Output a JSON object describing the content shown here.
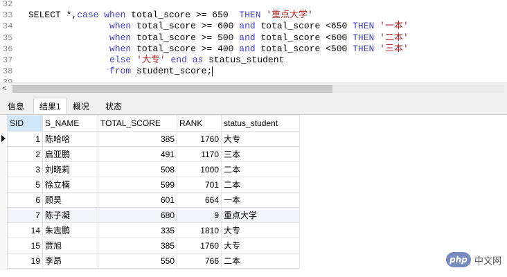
{
  "editor": {
    "lines": [
      {
        "num": "32",
        "parts": []
      },
      {
        "num": "33",
        "parts": [
          [
            "",
            "SELECT *,"
          ],
          [
            "kw",
            "case"
          ],
          [
            "",
            " "
          ],
          [
            "kw",
            "when"
          ],
          [
            "",
            " total_score >= 650  "
          ],
          [
            "kw",
            "THEN"
          ],
          [
            "",
            " "
          ],
          [
            "str",
            "'重点大学'"
          ]
        ]
      },
      {
        "num": "34",
        "parts": [
          [
            "",
            "               "
          ],
          [
            "kw",
            "when"
          ],
          [
            "",
            " total_score >= 600 "
          ],
          [
            "kw",
            "and"
          ],
          [
            "",
            " total_score <650 "
          ],
          [
            "kw",
            "THEN"
          ],
          [
            "",
            " "
          ],
          [
            "str",
            "'一本'"
          ]
        ]
      },
      {
        "num": "35",
        "parts": [
          [
            "",
            "               "
          ],
          [
            "kw",
            "when"
          ],
          [
            "",
            " total_score >= 500 "
          ],
          [
            "kw",
            "and"
          ],
          [
            "",
            " total_score <600 "
          ],
          [
            "kw",
            "THEN"
          ],
          [
            "",
            " "
          ],
          [
            "str",
            "'二本'"
          ]
        ]
      },
      {
        "num": "36",
        "parts": [
          [
            "",
            "               "
          ],
          [
            "kw",
            "when"
          ],
          [
            "",
            " total_score >= 400 "
          ],
          [
            "kw",
            "and"
          ],
          [
            "",
            " total_score <500 "
          ],
          [
            "kw",
            "THEN"
          ],
          [
            "",
            " "
          ],
          [
            "str",
            "'三本'"
          ]
        ]
      },
      {
        "num": "37",
        "parts": [
          [
            "",
            "               "
          ],
          [
            "kw",
            "else"
          ],
          [
            "",
            " "
          ],
          [
            "str",
            "'大专'"
          ],
          [
            "",
            " "
          ],
          [
            "kw",
            "end"
          ],
          [
            "",
            " "
          ],
          [
            "kw",
            "as"
          ],
          [
            "",
            " status_student"
          ]
        ]
      },
      {
        "num": "38",
        "parts": [
          [
            "",
            "               "
          ],
          [
            "kw",
            "from"
          ],
          [
            "",
            " student_score;"
          ]
        ]
      },
      {
        "num": "39",
        "parts": []
      }
    ]
  },
  "scrollbar": {
    "left_arrow": "<"
  },
  "tabs": [
    {
      "label": "信息",
      "active": false
    },
    {
      "label": "结果1",
      "active": true
    },
    {
      "label": "概况",
      "active": false
    },
    {
      "label": "状态",
      "active": false
    }
  ],
  "table": {
    "columns": [
      "SID",
      "S_NAME",
      "TOTAL_SCORE",
      "RANK",
      "status_student"
    ],
    "rows": [
      [
        "1",
        "陈哈哈",
        "385",
        "1760",
        "大专"
      ],
      [
        "2",
        "启亚鹏",
        "491",
        "1170",
        "三本"
      ],
      [
        "3",
        "刘晓莉",
        "508",
        "1000",
        "二本"
      ],
      [
        "5",
        "徐立楠",
        "599",
        "701",
        "二本"
      ],
      [
        "6",
        "顾昊",
        "601",
        "664",
        "一本"
      ],
      [
        "7",
        "陈子凝",
        "680",
        "9",
        "重点大学"
      ],
      [
        "14",
        "朱志鹏",
        "335",
        "1810",
        "大专"
      ],
      [
        "15",
        "贾旭",
        "385",
        "1760",
        "大专"
      ],
      [
        "19",
        "李昂",
        "550",
        "766",
        "二本"
      ]
    ]
  },
  "watermark": {
    "logo": "php",
    "text": "中文网"
  }
}
